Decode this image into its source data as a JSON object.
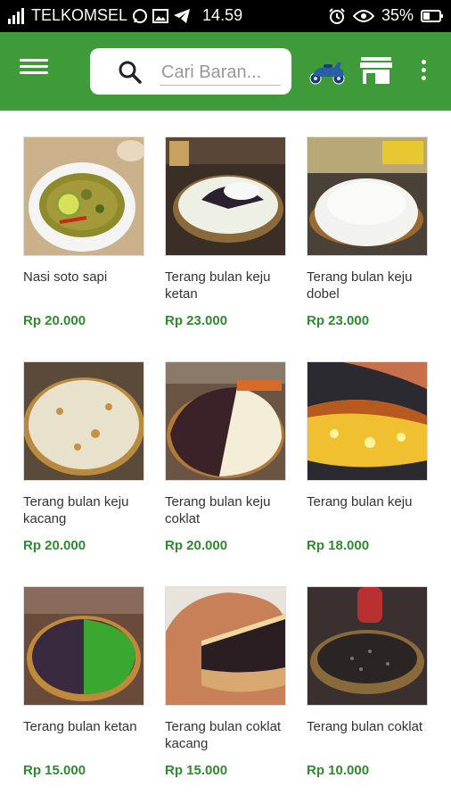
{
  "status_bar": {
    "carrier": "TELKOMSEL",
    "time": "14.59",
    "battery": "35%",
    "icons": [
      "signal-icon",
      "whatsapp-icon",
      "gallery-icon",
      "telegram-icon",
      "alarm-icon",
      "eye-icon"
    ]
  },
  "app_bar": {
    "search_placeholder": "Cari Baran...",
    "icons": [
      "menu-icon",
      "search-icon",
      "scooter-icon",
      "store-icon",
      "more-vert-icon"
    ]
  },
  "products": [
    {
      "name": "Nasi soto sapi",
      "price": "Rp 20.000"
    },
    {
      "name": "Terang bulan keju ketan",
      "price": "Rp 23.000"
    },
    {
      "name": "Terang bulan keju dobel",
      "price": "Rp 23.000"
    },
    {
      "name": "Terang bulan keju kacang",
      "price": "Rp 20.000"
    },
    {
      "name": "Terang bulan keju coklat",
      "price": "Rp 20.000"
    },
    {
      "name": "Terang bulan keju",
      "price": "Rp 18.000"
    },
    {
      "name": "Terang bulan ketan",
      "price": "Rp 15.000"
    },
    {
      "name": "Terang bulan coklat kacang",
      "price": "Rp 15.000"
    },
    {
      "name": "Terang bulan coklat",
      "price": "Rp 10.000"
    }
  ],
  "colors": {
    "primary": "#3f9a3a",
    "price": "#2e8b2e"
  }
}
